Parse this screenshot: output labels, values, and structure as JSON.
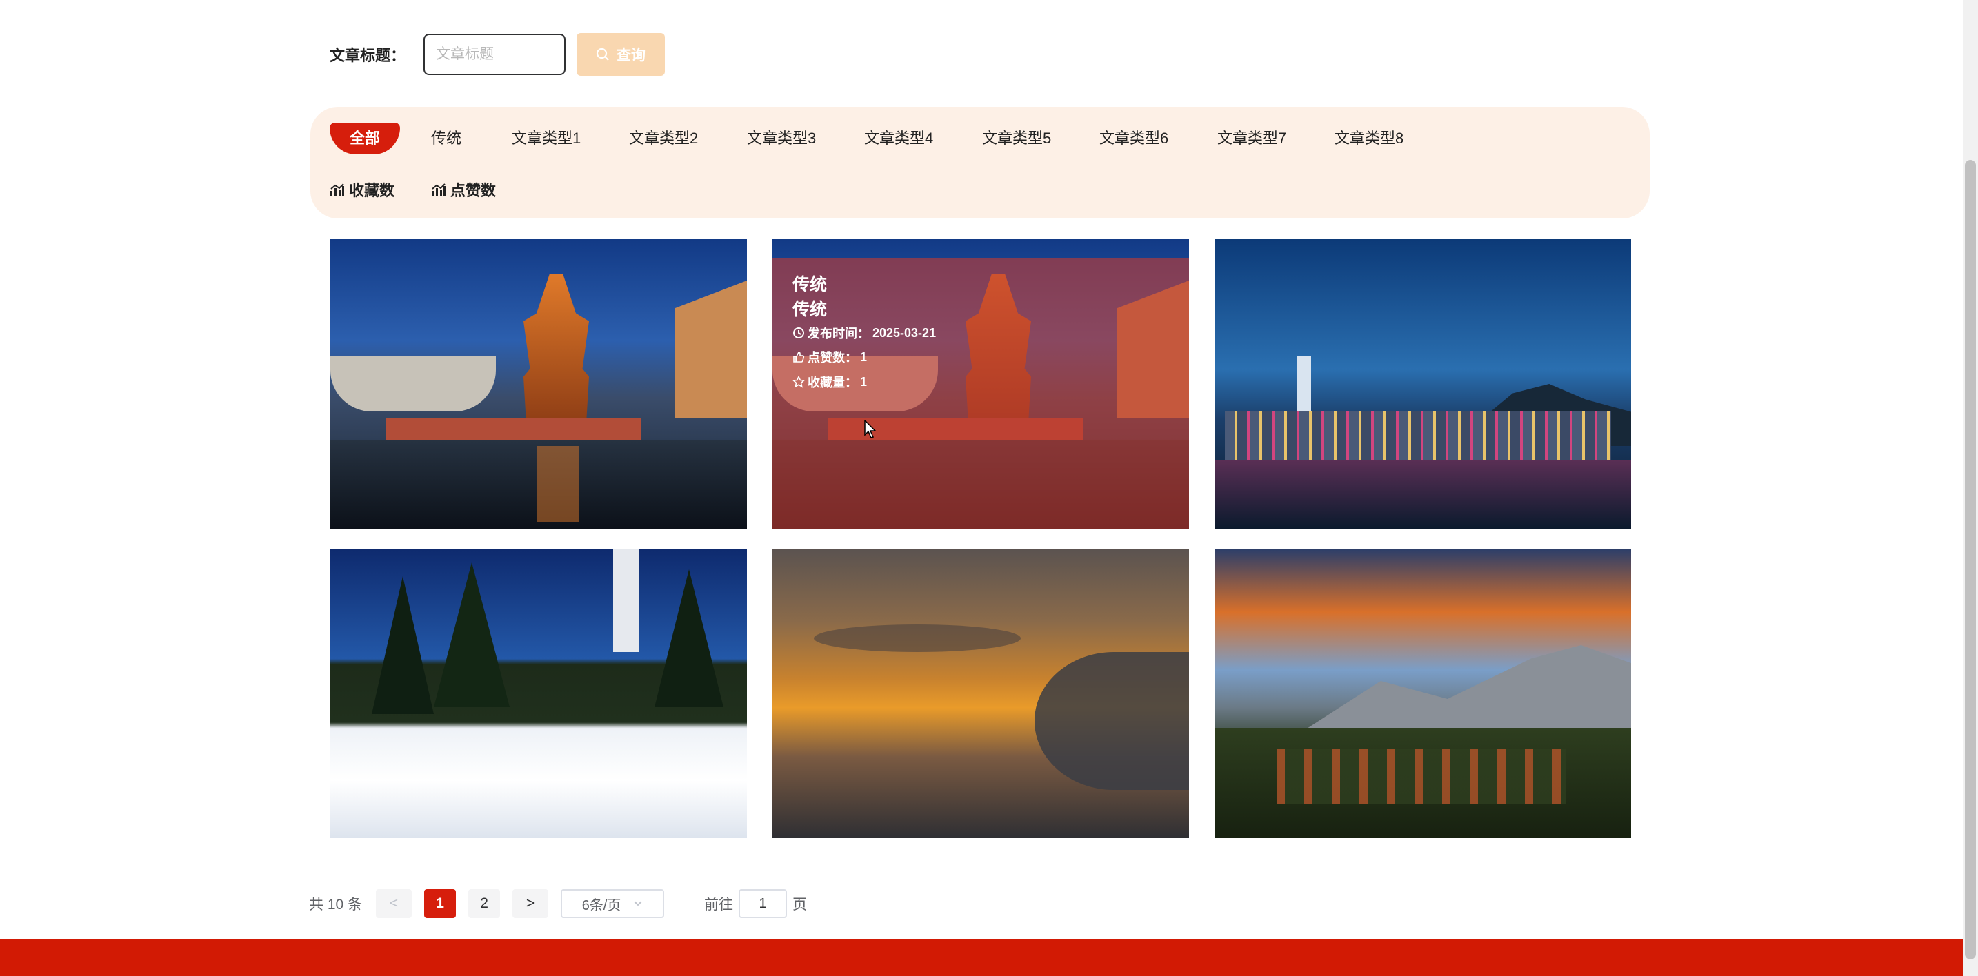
{
  "search": {
    "label": "文章标题：",
    "placeholder": "文章标题",
    "value": "",
    "button_label": "查询"
  },
  "categories": [
    {
      "label": "全部",
      "active": true
    },
    {
      "label": "传统"
    },
    {
      "label": "文章类型1"
    },
    {
      "label": "文章类型2"
    },
    {
      "label": "文章类型3"
    },
    {
      "label": "文章类型4"
    },
    {
      "label": "文章类型5"
    },
    {
      "label": "文章类型6"
    },
    {
      "label": "文章类型7"
    },
    {
      "label": "文章类型8"
    }
  ],
  "sort_options": [
    {
      "label": "收藏数",
      "icon": "bar-chart-icon"
    },
    {
      "label": "点赞数",
      "icon": "bar-chart-icon"
    }
  ],
  "cards": [
    {
      "image": "pavilion-night-reflection"
    },
    {
      "image": "pavilion-night-reflection",
      "hovered": true,
      "overlay": {
        "title": "传统",
        "subtitle": "传统",
        "publish_label": "发布时间：",
        "publish_date": "2025-03-21",
        "likes_label": "点赞数：",
        "likes": "1",
        "favorites_label": "收藏量：",
        "favorites": "1"
      }
    },
    {
      "image": "city-skyline-night"
    },
    {
      "image": "snow-forest-lighthouse"
    },
    {
      "image": "sunset-clouds"
    },
    {
      "image": "mountain-sunset-forest"
    }
  ],
  "pagination": {
    "total_text": "共 10 条",
    "prev": "<",
    "next": ">",
    "pages": [
      "1",
      "2"
    ],
    "current": "1",
    "page_size": "6条/页",
    "goto_label": "前往",
    "goto_value": "1",
    "goto_suffix": "页"
  },
  "colors": {
    "primary": "#d61e0c",
    "panel_bg": "#fdf0e6",
    "search_button": "#f9d7b0",
    "footer": "#d21a04"
  }
}
